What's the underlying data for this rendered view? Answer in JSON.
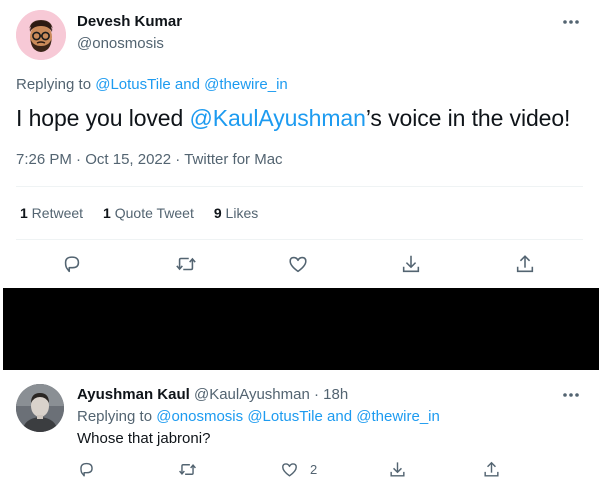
{
  "main_tweet": {
    "author_name": "Devesh Kumar",
    "author_handle": "@onosmosis",
    "replying_prefix": "Replying to ",
    "replying_mention_1": "@LotusTile",
    "replying_and": " and ",
    "replying_mention_2": "@thewire_in",
    "text_before": "I hope you loved ",
    "text_mention": "@KaulAyushman",
    "text_after": "’s voice in the video!",
    "time": "7:26 PM",
    "date": "Oct 15, 2022",
    "source": "Twitter for Mac",
    "separator": " · ",
    "retweets_count": "1",
    "retweets_label": " Retweet",
    "quotes_count": "1",
    "quotes_label": " Quote Tweet",
    "likes_count": "9",
    "likes_label": " Likes"
  },
  "reply_tweet": {
    "author_name": "Ayushman Kaul",
    "author_handle": " @KaulAyushman",
    "time_sep": " · ",
    "time": "18h",
    "replying_prefix": "Replying to ",
    "replying_mention_1": "@onosmosis",
    "replying_mention_2": " @LotusTile",
    "replying_and": " and ",
    "replying_mention_3": "@thewire_in",
    "text": "Whose that jabroni?",
    "like_count": "2"
  },
  "icons": {
    "more": "more-icon",
    "reply": "reply-icon",
    "retweet": "retweet-icon",
    "like": "heart-icon",
    "bookmark": "bookmark-icon",
    "share": "share-icon"
  },
  "colors": {
    "accent": "#1d9bf0",
    "secondary_text": "#536471",
    "divider": "#eff3f4",
    "redaction": "#000000"
  }
}
